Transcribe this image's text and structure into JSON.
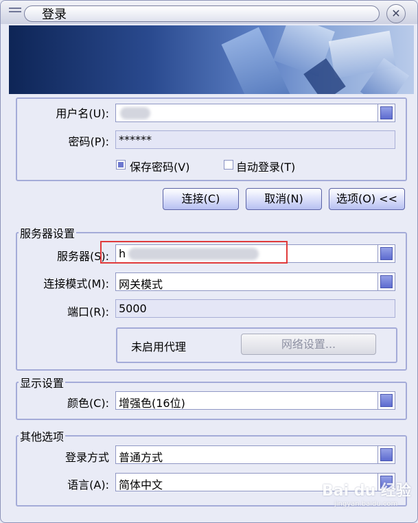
{
  "window": {
    "title": "登录",
    "close_glyph": "✕"
  },
  "login": {
    "username_label": "用户名(U):",
    "password_label": "密码(P):",
    "password_value": "******",
    "save_password_label": "保存密码(V)",
    "save_password_checked": true,
    "auto_login_label": "自动登录(T)",
    "auto_login_checked": false
  },
  "buttons": {
    "connect": "连接(C)",
    "cancel": "取消(N)",
    "options": "选项(O) <<"
  },
  "server_settings": {
    "legend": "服务器设置",
    "server_label": "服务器(S):",
    "server_value_prefix": "h",
    "mode_label": "连接模式(M):",
    "mode_value": "网关模式",
    "port_label": "端口(R):",
    "port_value": "5000",
    "proxy_status": "未启用代理",
    "network_settings_button": "网络设置..."
  },
  "display_settings": {
    "legend": "显示设置",
    "color_label": "颜色(C):",
    "color_value": "增强色(16位)"
  },
  "other_options": {
    "legend": "其他选项",
    "login_method_label": "登录方式",
    "login_method_value": "普通方式",
    "language_label": "语言(A):",
    "language_value": "简体中文"
  },
  "watermark": {
    "text": "Bai du 经验",
    "sub": "jingyan.baidu.com"
  },
  "colors": {
    "accent": "#5d6bd0",
    "highlight_border": "#e03a3a",
    "panel_border": "#a4abd8"
  }
}
